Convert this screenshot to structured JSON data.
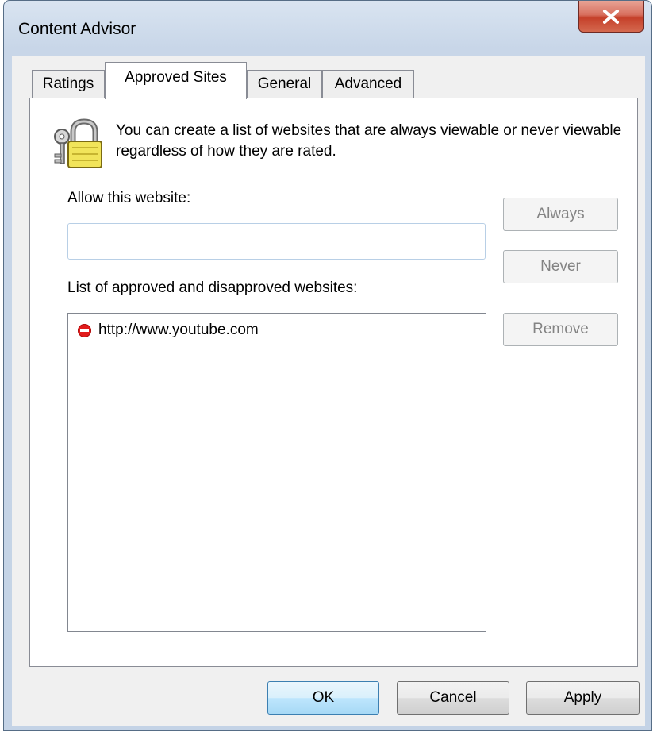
{
  "window": {
    "title": "Content Advisor",
    "close_glyph": "X"
  },
  "tabs": [
    {
      "label": "Ratings",
      "active": false
    },
    {
      "label": "Approved Sites",
      "active": true
    },
    {
      "label": "General",
      "active": false
    },
    {
      "label": "Advanced",
      "active": false
    }
  ],
  "panel": {
    "icon": "keys-padlock-icon",
    "description": "You can create a list of websites that are always viewable or never viewable regardless of how they are rated.",
    "allow_label": "Allow this website:",
    "url_input_value": "",
    "list_label": "List of approved and disapproved websites:",
    "sites": [
      {
        "url": "http://www.youtube.com",
        "status": "never",
        "icon": "blocked-icon"
      }
    ],
    "buttons": {
      "always": "Always",
      "never": "Never",
      "remove": "Remove"
    }
  },
  "footer": {
    "ok": "OK",
    "cancel": "Cancel",
    "apply": "Apply"
  },
  "colors": {
    "frame": "#c4d3e6",
    "close_button": "#c5402a",
    "blocked": "#e21b1b",
    "default_button": "#3c7fb1"
  }
}
